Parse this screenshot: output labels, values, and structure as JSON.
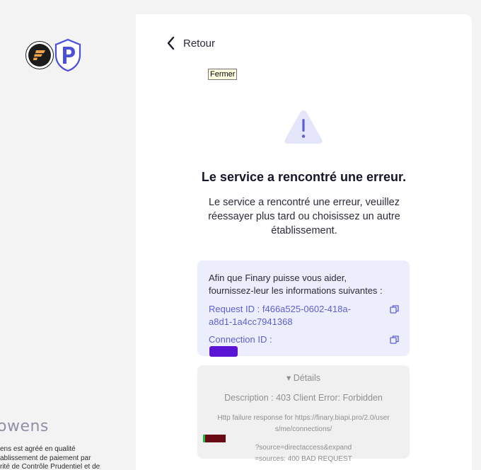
{
  "brand": {
    "finary_logo_icon": "finary-logo-icon",
    "powens_logo_icon": "powens-shield-icon",
    "powens_wordmark": "owens",
    "legal_lines": [
      "ens est agréé en qualité",
      "ablissement de paiement par",
      "rité de Contrôle Prudentiel et de"
    ]
  },
  "nav": {
    "back_label": "Retour",
    "tooltip": "Fermer"
  },
  "error": {
    "icon": "warning-triangle-icon",
    "title": "Le service a rencontré une erreur.",
    "message_lines": [
      "Le service a rencontré une erreur, veuillez",
      "réessayer plus tard ou choisissez un autre",
      "établissement."
    ]
  },
  "support": {
    "intro_lines": [
      "Afin que Finary puisse vous aider,",
      "fournissez-leur les informations suivantes :"
    ],
    "request_id_lines": [
      "Request ID : f466a525-0602-418a-",
      "a8d1-1a4cc7941368"
    ],
    "connection_id_label": "Connection ID :"
  },
  "details": {
    "toggle_label": "▾ Détails",
    "description": "Description : 403 Client Error: Forbidden",
    "error_line1": "Http failure response for https://finary.biapi.pro/2.0/user",
    "error_line2_start": "s/me/connections/",
    "error_line2_end": "?source=directaccess&expand",
    "error_line3": "=sources: 400 BAD REQUEST"
  },
  "colors": {
    "accent": "#5c5fd6",
    "info_bg": "#eceefb",
    "warning_bg": "#e4e5f9"
  }
}
